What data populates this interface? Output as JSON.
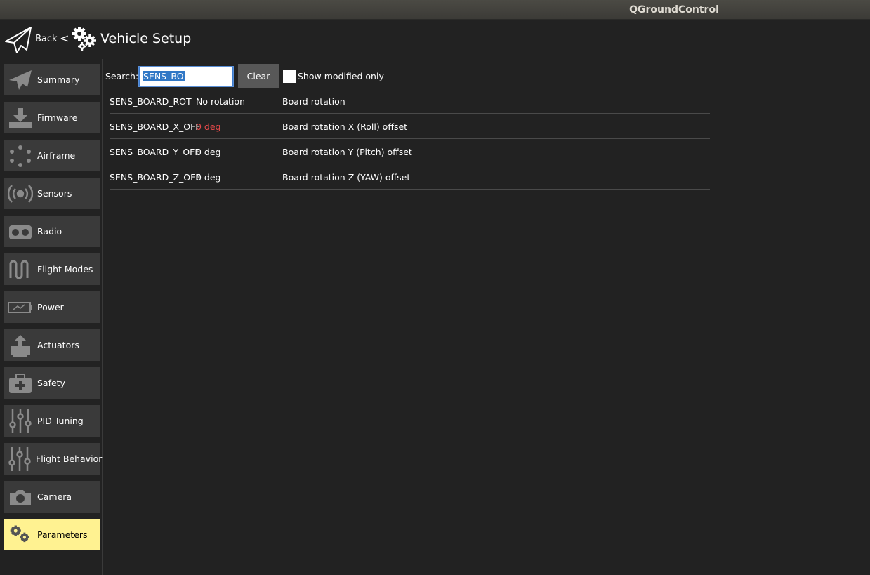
{
  "window": {
    "title": "QGroundControl"
  },
  "toolbar": {
    "back_label": "Back",
    "chevron": "<",
    "title": "Vehicle Setup"
  },
  "sidebar": {
    "items": [
      {
        "label": "Summary",
        "icon": "plane-icon"
      },
      {
        "label": "Firmware",
        "icon": "download-icon"
      },
      {
        "label": "Airframe",
        "icon": "airframe-icon"
      },
      {
        "label": "Sensors",
        "icon": "sensors-icon"
      },
      {
        "label": "Radio",
        "icon": "radio-icon"
      },
      {
        "label": "Flight Modes",
        "icon": "flight-modes-icon"
      },
      {
        "label": "Power",
        "icon": "battery-icon"
      },
      {
        "label": "Actuators",
        "icon": "actuators-icon"
      },
      {
        "label": "Safety",
        "icon": "first-aid-icon"
      },
      {
        "label": "PID Tuning",
        "icon": "sliders-icon"
      },
      {
        "label": "Flight Behavior",
        "icon": "sliders-icon"
      },
      {
        "label": "Camera",
        "icon": "camera-icon"
      },
      {
        "label": "Parameters",
        "icon": "gears-icon",
        "active": true
      }
    ]
  },
  "search": {
    "label": "Search:",
    "value": "SENS_BO",
    "clear_label": "Clear",
    "show_modified_label": "Show modified only",
    "show_modified_checked": false
  },
  "params": [
    {
      "name": "SENS_BOARD_ROT",
      "value": "No rotation",
      "description": "Board rotation",
      "modified": false
    },
    {
      "name": "SENS_BOARD_X_OFF",
      "value": "0 deg",
      "description": "Board rotation X (Roll) offset",
      "modified": true
    },
    {
      "name": "SENS_BOARD_Y_OFF",
      "value": "0 deg",
      "description": "Board rotation Y (Pitch) offset",
      "modified": false
    },
    {
      "name": "SENS_BOARD_Z_OFF",
      "value": "0 deg",
      "description": "Board rotation Z (YAW) offset",
      "modified": false
    }
  ],
  "colors": {
    "accent": "#fff291",
    "modified": "#e84a4a",
    "background": "#222222",
    "button": "#3a3a3a"
  }
}
